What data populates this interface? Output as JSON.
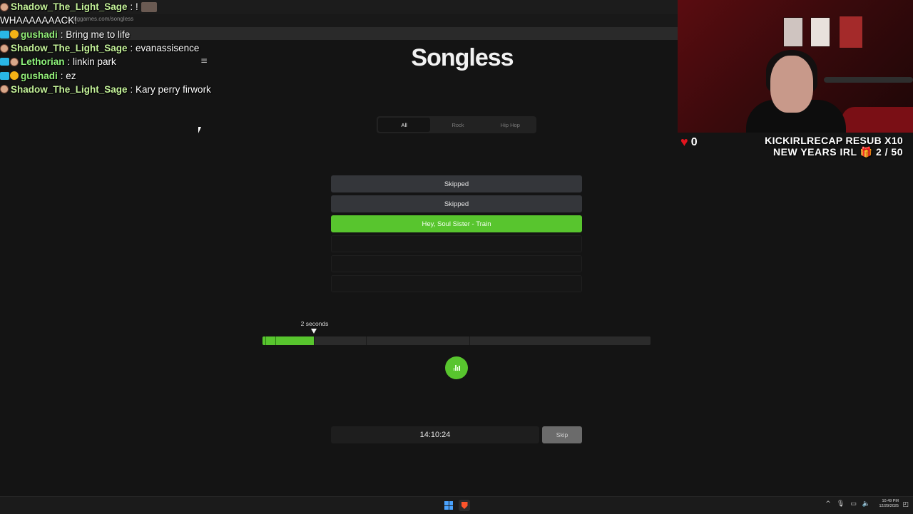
{
  "browser": {
    "url": "...songgames.com/songless",
    "menu_icon": "hamburger-icon"
  },
  "chat": [
    {
      "badges": [
        "chef",
        "avatar"
      ],
      "user": "Shadow_The_Light_Sage",
      "message": "!"
    },
    {
      "badges": [],
      "user": "",
      "message": "WHAAAAAAACK!"
    },
    {
      "badges": [
        "sub",
        "gold"
      ],
      "user": "gushadi",
      "message": "Bring me to life"
    },
    {
      "badges": [
        "chef"
      ],
      "user": "Shadow_The_Light_Sage",
      "message": "evanassisence"
    },
    {
      "badges": [
        "sub",
        "ninja"
      ],
      "user": "Lethorian",
      "message": "linkin park"
    },
    {
      "badges": [
        "sub",
        "gold"
      ],
      "user": "gushadi",
      "message": "ez"
    },
    {
      "badges": [
        "chef"
      ],
      "user": "Shadow_The_Light_Sage",
      "message": "Kary perry firwork"
    }
  ],
  "game": {
    "title": "Songless",
    "tabs": [
      "All",
      "Rock",
      "Hip Hop"
    ],
    "active_tab": "All",
    "guesses": [
      {
        "text": "Skipped",
        "state": "skipped"
      },
      {
        "text": "Skipped",
        "state": "skipped"
      },
      {
        "text": "Hey, Soul Sister - Train",
        "state": "correct"
      },
      {
        "text": "",
        "state": "empty"
      },
      {
        "text": "",
        "state": "empty"
      },
      {
        "text": "",
        "state": "empty"
      }
    ],
    "seconds_label": "2 seconds",
    "timer": "14:10:24",
    "skip_label": "Skip",
    "play_icon": "equalizer-bars-icon",
    "accent_color": "#58c52e"
  },
  "stream_overlay": {
    "heart_count": "0",
    "line1": "KICKIRLRECAP RESUB X10",
    "line2_prefix": "NEW YEARS IRL",
    "line2_progress": "2 / 50",
    "gift_icon": "gift-icon"
  },
  "taskbar": {
    "time": "10:49 PM",
    "date": "12/29/2025"
  }
}
